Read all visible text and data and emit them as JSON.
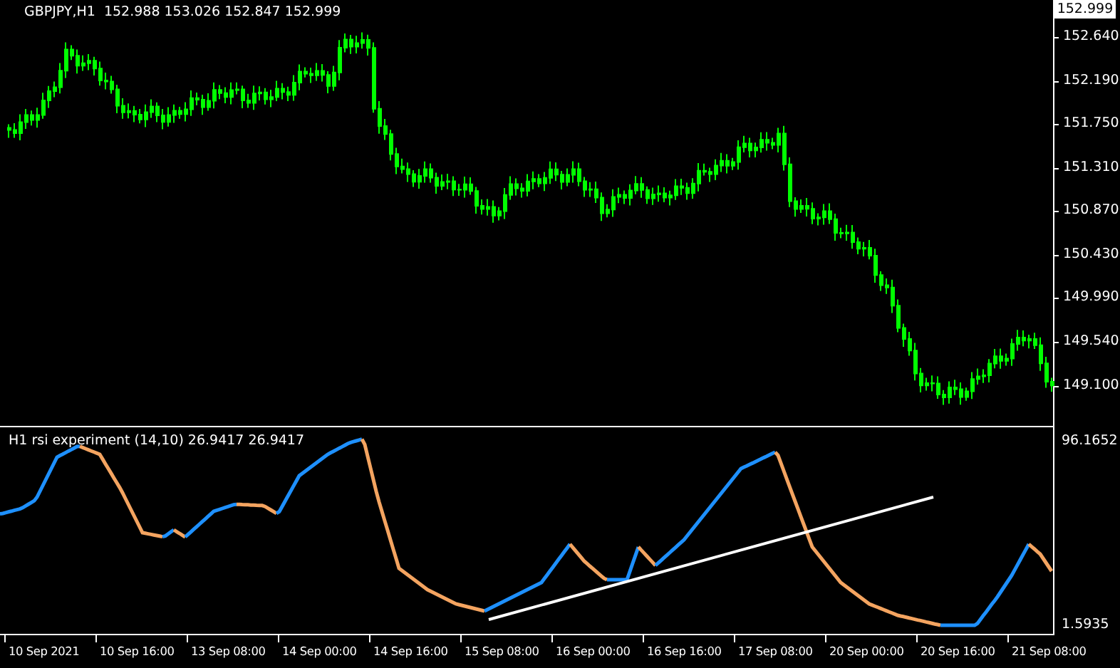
{
  "main_chart": {
    "symbol": "GBPJPY,H1",
    "quote": "152.988 153.026 152.847 152.999"
  },
  "price_axis": {
    "current": "152.999",
    "labels": [
      "152.640",
      "152.190",
      "151.750",
      "151.310",
      "150.870",
      "150.430",
      "149.990",
      "149.540",
      "149.100"
    ]
  },
  "indicator": {
    "title": "H1 rsi experiment (14,10) 26.9417 26.9417",
    "axis_labels": [
      "96.1652",
      "1.5935"
    ]
  },
  "time_axis": [
    "10 Sep 2021",
    "10 Sep 16:00",
    "13 Sep 08:00",
    "14 Sep 00:00",
    "14 Sep 16:00",
    "15 Sep 08:00",
    "16 Sep 00:00",
    "16 Sep 16:00",
    "17 Sep 08:00",
    "20 Sep 00:00",
    "20 Sep 16:00",
    "21 Sep 08:00"
  ]
}
